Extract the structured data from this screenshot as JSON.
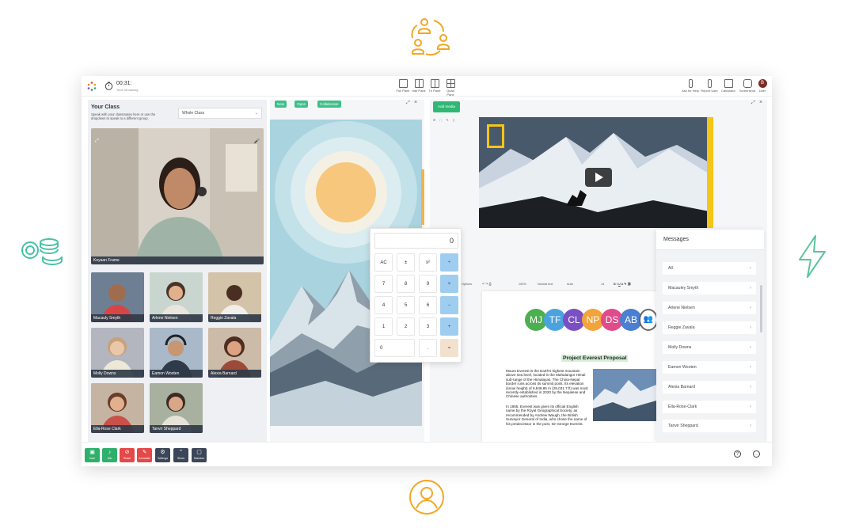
{
  "decor": {
    "top_icon": "people-exchange-icon",
    "left_icon": "coins-icon",
    "right_icon": "lightning-icon",
    "bottom_icon": "user-circle-icon",
    "accent_orange": "#f5a623",
    "accent_teal": "#48c2a6",
    "accent_green": "#5dc39c"
  },
  "topbar": {
    "timer": "00:31:",
    "timer_sub": "Time remaining",
    "layouts": [
      "Full Pane",
      "Half Pane",
      "Tri Pane",
      "Quad Pane"
    ],
    "tools": [
      "Ask for Help",
      "Report User",
      "Calculator",
      "Screenshot",
      "User"
    ],
    "user_initial": "B"
  },
  "left": {
    "title": "Your Class",
    "subtitle": "Speak with your classmates here or use the dropdown to speak to a different group.",
    "dropdown": "Whole Class",
    "main_name": "Keyaan Frame",
    "tiles": [
      "Macauly Smyth",
      "Arlene Nielsen",
      "Reggie Zavala",
      "Molly Downs",
      "Eamon Wooten",
      "Alexia Barnard",
      "Ella-Rose Clark",
      "Tanvir Sheppard"
    ]
  },
  "middle": {
    "buttons": [
      "New",
      "Open",
      "Collaborate"
    ]
  },
  "calculator": {
    "display": "0",
    "keys": [
      "AC",
      "±",
      "x²",
      "÷",
      "7",
      "8",
      "9",
      "×",
      "4",
      "5",
      "6",
      "−",
      "1",
      "2",
      "3",
      "+",
      "0",
      ".",
      "="
    ]
  },
  "right": {
    "add_media": "Add media",
    "doc_title": "Project Everest Proposal",
    "doc_badges": [
      "MJ",
      "TF",
      "CL",
      "NP",
      "DS",
      "AB"
    ],
    "doc_text_1": "Mount Everest is the Earth's highest mountain above sea level, located in the Mahalangur Himal sub-range of the Himalayas. The China-Nepal border runs across its summit point. Its elevation (snow height) of 8,848.86 m (29,031.7 ft) was most recently established in 2020 by the Nepalese and Chinese authorities.",
    "doc_text_2": "In 1865, Everest was given its official English name by the Royal Geographical Society, as recommended by Andrew Waugh, the British Surveyor General of India, who chose the name of his predecessor in the post, Sir George Everest.",
    "toolbar_font": "Arial",
    "toolbar_style": "Normal text",
    "toolbar_size": "14",
    "toolbar_zoom": "100%",
    "toolbar_options": "Options"
  },
  "messages": {
    "title": "Messages",
    "items": [
      "All",
      "Macauley Smyth",
      "Arlene Nielsen",
      "Reggie Zavala",
      "Molly Downs",
      "Eamon Wooten",
      "Alexia Barnard",
      "Ella-Rose-Clark",
      "Tanvir Sheppard"
    ]
  },
  "bottom": {
    "buttons": [
      "Cam",
      "Mic",
      "Share",
      "Annotate",
      "Settings",
      "Show",
      "Mainbar"
    ]
  }
}
